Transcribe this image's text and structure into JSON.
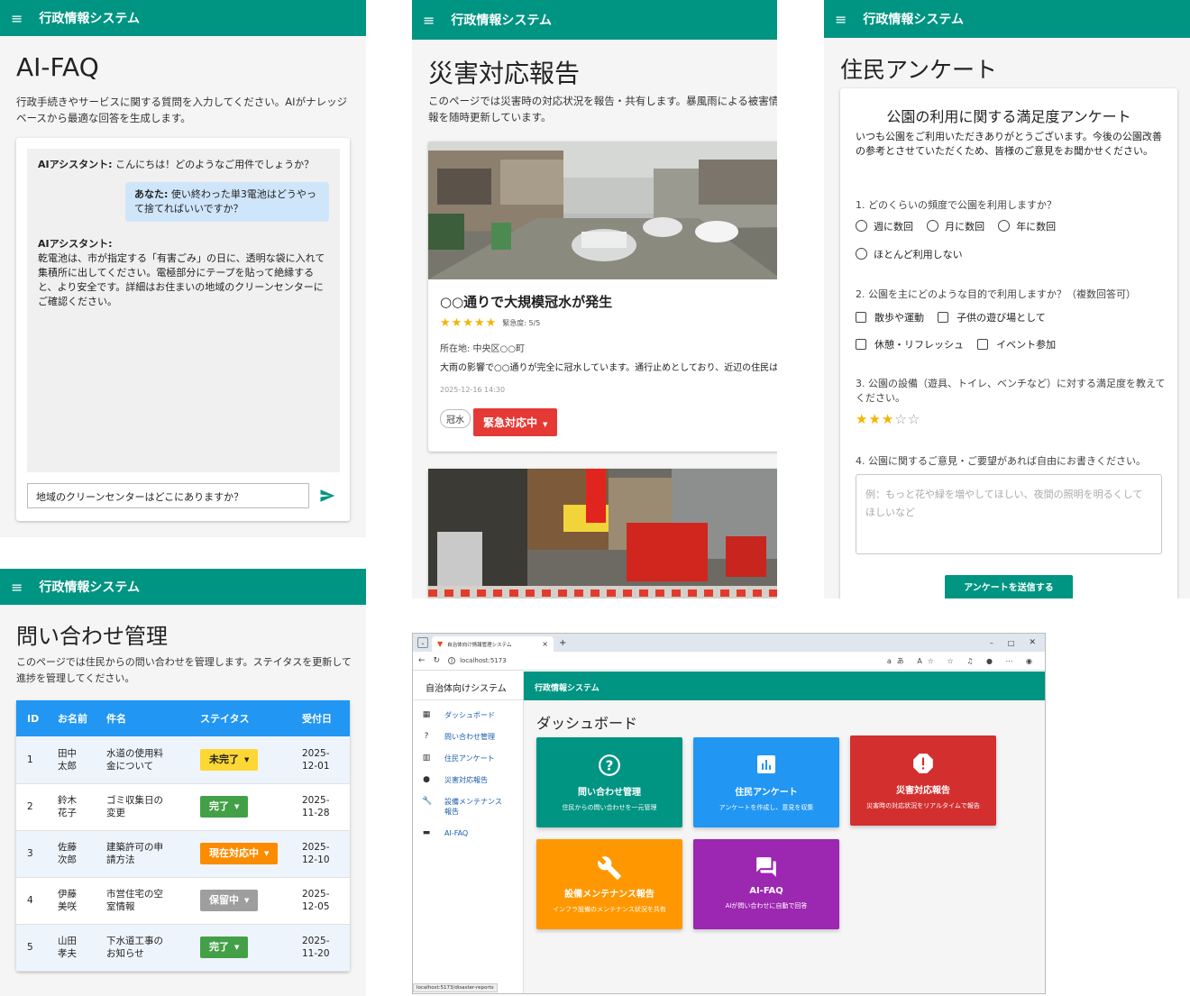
{
  "app_title": "行政情報システム",
  "faq": {
    "title": "AI-FAQ",
    "desc": "行政手続きやサービスに関する質問を入力してください。AIがナレッジベースから最適な回答を生成します。",
    "m1_who": "AIアシスタント:",
    "m1_text": "こんにちは！どのようなご用件でしょうか？",
    "m2_who": "あなた:",
    "m2_text": "使い終わった単3電池はどうやって捨てればいいですか？",
    "m3_who": "AIアシスタント:",
    "m3_text": "乾電池は、市が指定する「有害ごみ」の日に、透明な袋に入れて集積所に出してください。電極部分にテープを貼って絶縁すると、より安全です。詳細はお住まいの地域のクリーンセンターにご確認ください。",
    "input_value": "地域のクリーンセンターはどこにありますか？"
  },
  "disaster": {
    "title": "災害対応報告",
    "desc": "このページでは災害時の対応状況を報告・共有します。暴風雨による被害情報を随時更新しています。",
    "card_title": "○○通りで大規模冠水が発生",
    "stars": "★★★★★",
    "urgency": "緊急度: 5/5",
    "location": "所在地: 中央区○○町",
    "body": "大雨の影響で○○通りが完全に冠水しています。通行止めとしており、近辺の住民は注意してください。",
    "date": "2025-12-16 14:30",
    "chip": "冠水",
    "status": "緊急対応中"
  },
  "survey": {
    "title": "住民アンケート",
    "heading": "公園の利用に関する満足度アンケート",
    "intro": "いつも公園をご利用いただきありがとうございます。今後の公園改善の参考とさせていただくため、皆様のご意見をお聞かせください。",
    "q1": "1. どのくらいの頻度で公園を利用しますか？",
    "q1_opts": [
      "週に数回",
      "月に数回",
      "年に数回",
      "ほとんど利用しない"
    ],
    "q2": "2. 公園を主にどのような目的で利用しますか？（複数回答可）",
    "q2_opts": [
      "散歩や運動",
      "子供の遊び場として",
      "休憩・リフレッシュ",
      "イベント参加"
    ],
    "q3": "3. 公園の設備（遊具、トイレ、ベンチなど）に対する満足度を教えてください。",
    "rating": 3,
    "q4": "4. 公園に関するご意見・ご要望があれば自由にお書きください。",
    "placeholder": "例：もっと花や緑を増やしてほしい、夜間の照明を明るくしてほしいなど",
    "submit": "アンケートを送信する"
  },
  "inquiry": {
    "title": "問い合わせ管理",
    "desc": "このページでは住民からの問い合わせを管理します。ステイタスを更新して進捗を管理してください。",
    "headers": [
      "ID",
      "お名前",
      "件名",
      "ステイタス",
      "受付日"
    ],
    "rows": [
      {
        "id": "1",
        "name": "田中太郎",
        "subject": "水道の使用料金について",
        "status": "未完了",
        "color": "#fdd835",
        "fg": "#222",
        "date": "2025-12-01"
      },
      {
        "id": "2",
        "name": "鈴木花子",
        "subject": "ゴミ収集日の変更",
        "status": "完了",
        "color": "#43a047",
        "fg": "#fff",
        "date": "2025-11-28"
      },
      {
        "id": "3",
        "name": "佐藤次郎",
        "subject": "建築許可の申請方法",
        "status": "現在対応中",
        "color": "#fb8c00",
        "fg": "#fff",
        "date": "2025-12-10"
      },
      {
        "id": "4",
        "name": "伊藤美咲",
        "subject": "市営住宅の空室情報",
        "status": "保留中",
        "color": "#9e9e9e",
        "fg": "#fff",
        "date": "2025-12-05"
      },
      {
        "id": "5",
        "name": "山田孝夫",
        "subject": "下水道工事のお知らせ",
        "status": "完了",
        "color": "#43a047",
        "fg": "#fff",
        "date": "2025-11-20"
      }
    ]
  },
  "browser": {
    "tab": "自治体向け情報管理システム",
    "url": "localhost:5173",
    "status_url": "localhost:5173/disaster-reports",
    "side_title": "自治体向けシステム",
    "page_title": "ダッシュボード",
    "side": [
      "ダッシュボード",
      "問い合わせ管理",
      "住民アンケート",
      "災害対応報告",
      "設備メンテナンス報告",
      "AI-FAQ"
    ],
    "tiles": [
      {
        "title": "問い合わせ管理",
        "sub": "住民からの問い合わせを一元管理",
        "color": "#009482",
        "icon": "?"
      },
      {
        "title": "住民アンケート",
        "sub": "アンケートを作成し、意見を収集",
        "color": "#2196f3",
        "icon": "chart"
      },
      {
        "title": "災害対応報告",
        "sub": "災害時の対応状況をリアルタイムで報告",
        "color": "#d32f2f",
        "icon": "!"
      },
      {
        "title": "設備メンテナンス報告",
        "sub": "インフラ設備のメンテナンス状況を共有",
        "color": "#ff9800",
        "icon": "wrench"
      },
      {
        "title": "AI-FAQ",
        "sub": "AIが問い合わせに自動で回答",
        "color": "#9c27b0",
        "icon": "chat"
      }
    ]
  }
}
